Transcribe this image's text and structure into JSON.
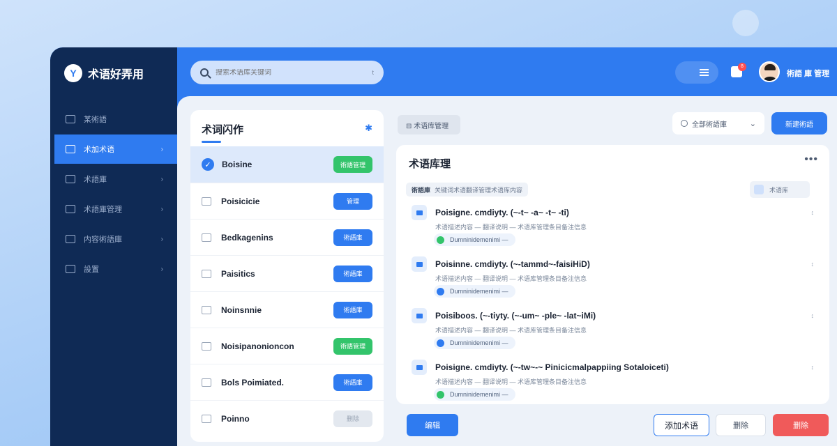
{
  "app": {
    "title": "术语好弄用",
    "logo_glyph": "Y"
  },
  "header": {
    "search_placeholder": "搜索术语库关键词",
    "search_kbd": "t",
    "notification_count": "8",
    "username": "術語 庫 管理"
  },
  "sidebar": {
    "items": [
      {
        "label": "某術語",
        "icon": "monitor-icon",
        "active": false,
        "chevron": ""
      },
      {
        "label": "术加术语",
        "icon": "term-icon",
        "active": true,
        "chevron": "›"
      },
      {
        "label": "术語庫",
        "icon": "database-icon",
        "active": false,
        "chevron": "›"
      },
      {
        "label": "术語庫管理",
        "icon": "folder-icon",
        "active": false,
        "chevron": "›"
      },
      {
        "label": "内容術語庫",
        "icon": "document-icon",
        "active": false,
        "chevron": "›"
      },
      {
        "label": "設置",
        "icon": "settings-icon",
        "active": false,
        "chevron": "›"
      }
    ]
  },
  "left_panel": {
    "title": "术词闪作",
    "rows": [
      {
        "label": "Boisine",
        "button": "術語管理",
        "style": "green",
        "selected": true
      },
      {
        "label": "Poisicicie",
        "button": "管理",
        "style": "blue",
        "selected": false
      },
      {
        "label": "Bedkagenins",
        "button": "術語庫",
        "style": "blue",
        "selected": false
      },
      {
        "label": "Paisitics",
        "button": "術語庫",
        "style": "blue",
        "selected": false
      },
      {
        "label": "Noinsnnie",
        "button": "術語庫",
        "style": "blue",
        "selected": false
      },
      {
        "label": "Noisipanonioncon",
        "button": "術語管理",
        "style": "green",
        "selected": false
      },
      {
        "label": "Bols Poimiated.",
        "button": "術語庫",
        "style": "blue",
        "selected": false
      },
      {
        "label": "Poinno",
        "button": "删除",
        "style": "gray",
        "selected": false
      }
    ]
  },
  "toolbar": {
    "chip_label": "⊟ 术语库管理",
    "select_label": "全部術語庫",
    "primary_button": "新建術語"
  },
  "right_panel": {
    "title": "术语库理",
    "filter_label": "術語庫",
    "filter_text": "关键词术语翻译管理术语库内容",
    "tag_label": "术语库",
    "entries": [
      {
        "title": "Poisigne. cmdiyty. (~-t~ -a~ -t~ -ti)",
        "desc": "术语描述内容 — 翻译说明 — 术语库管理条目备注信息",
        "badge": "Dumninidemenimi —",
        "dot": "green",
        "meta": "↕"
      },
      {
        "title": "Poisinne. cmdiyty. (~-tammd~-faisiHiD)",
        "desc": "术语描述内容 — 翻译说明 — 术语库管理条目备注信息",
        "badge": "Dumninidemenimi —",
        "dot": "blue",
        "meta": "↕"
      },
      {
        "title": "Poisiboos. (~-tiyty. (~-um~ -ple~ -lat~iMi)",
        "desc": "术语描述内容 — 翻译说明 — 术语库管理条目备注信息",
        "badge": "Dumninidemenimi —",
        "dot": "blue",
        "meta": "↕"
      },
      {
        "title": "Poisigne. cmdiyty. (~-tw~-~ Pinicicmalpappiing Sotaloiceti)",
        "desc": "术语描述内容 — 翻译说明 — 术语库管理条目备注信息",
        "badge": "Dumninidemenimi —",
        "dot": "green",
        "meta": "↕"
      }
    ]
  },
  "footer": {
    "edit_button": "编辑",
    "add_button": "添加术语",
    "cancel_button": "删除",
    "delete_button": "删除"
  },
  "colors": {
    "primary": "#2f7bf0",
    "sidebar": "#0f2a55",
    "success": "#33c46b",
    "danger": "#f05a5a"
  }
}
